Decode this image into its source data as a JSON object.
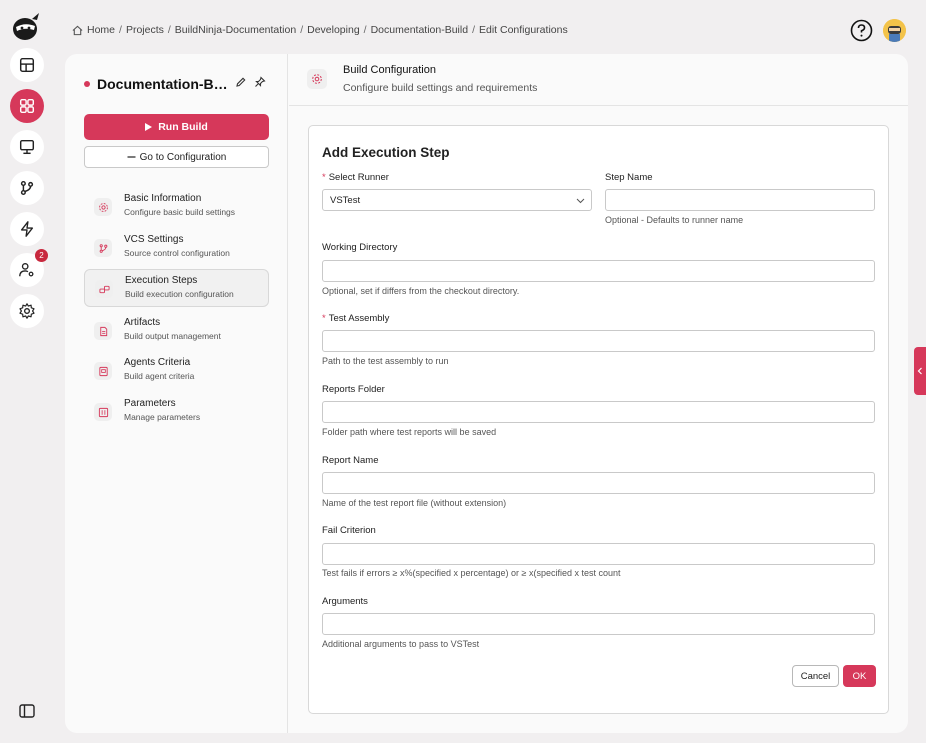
{
  "breadcrumb": {
    "items": [
      "Home",
      "Projects",
      "BuildNinja-Documentation",
      "Developing",
      "Documentation-Build",
      "Edit Configurations"
    ],
    "separator": "/"
  },
  "rail": {
    "notifications_badge": "2",
    "accent": "#d6385a"
  },
  "build": {
    "title": "Documentation-Build",
    "run_label": "Run Build",
    "goto_label": "Go to Configuration"
  },
  "nav": [
    {
      "title": "Basic Information",
      "sub": "Configure basic build settings"
    },
    {
      "title": "VCS Settings",
      "sub": "Source control configuration"
    },
    {
      "title": "Execution Steps",
      "sub": "Build execution configuration"
    },
    {
      "title": "Artifacts",
      "sub": "Build output management"
    },
    {
      "title": "Agents Criteria",
      "sub": "Build agent criteria"
    },
    {
      "title": "Parameters",
      "sub": "Manage parameters"
    }
  ],
  "header": {
    "title": "Build Configuration",
    "sub": "Configure build settings and requirements"
  },
  "form": {
    "title": "Add Execution Step",
    "runner": {
      "label": "Select Runner",
      "value": "VSTest"
    },
    "step_name": {
      "label": "Step Name",
      "hint": "Optional - Defaults to runner name",
      "value": ""
    },
    "working_dir": {
      "label": "Working Directory",
      "hint": "Optional, set if differs from the checkout directory.",
      "value": ""
    },
    "test_assembly": {
      "label": "Test Assembly",
      "hint": "Path to the test assembly to run",
      "value": ""
    },
    "reports_folder": {
      "label": "Reports Folder",
      "hint": "Folder path where test reports will be saved",
      "value": ""
    },
    "report_name": {
      "label": "Report Name",
      "hint": "Name of the test report file (without extension)",
      "value": ""
    },
    "fail_criterion": {
      "label": "Fail Criterion",
      "hint": "Test fails if errors ≥ x%(specified x percentage) or ≥ x(specified x test count",
      "value": ""
    },
    "arguments": {
      "label": "Arguments",
      "hint": "Additional arguments to pass to VSTest",
      "value": ""
    },
    "cancel_label": "Cancel",
    "ok_label": "OK"
  }
}
